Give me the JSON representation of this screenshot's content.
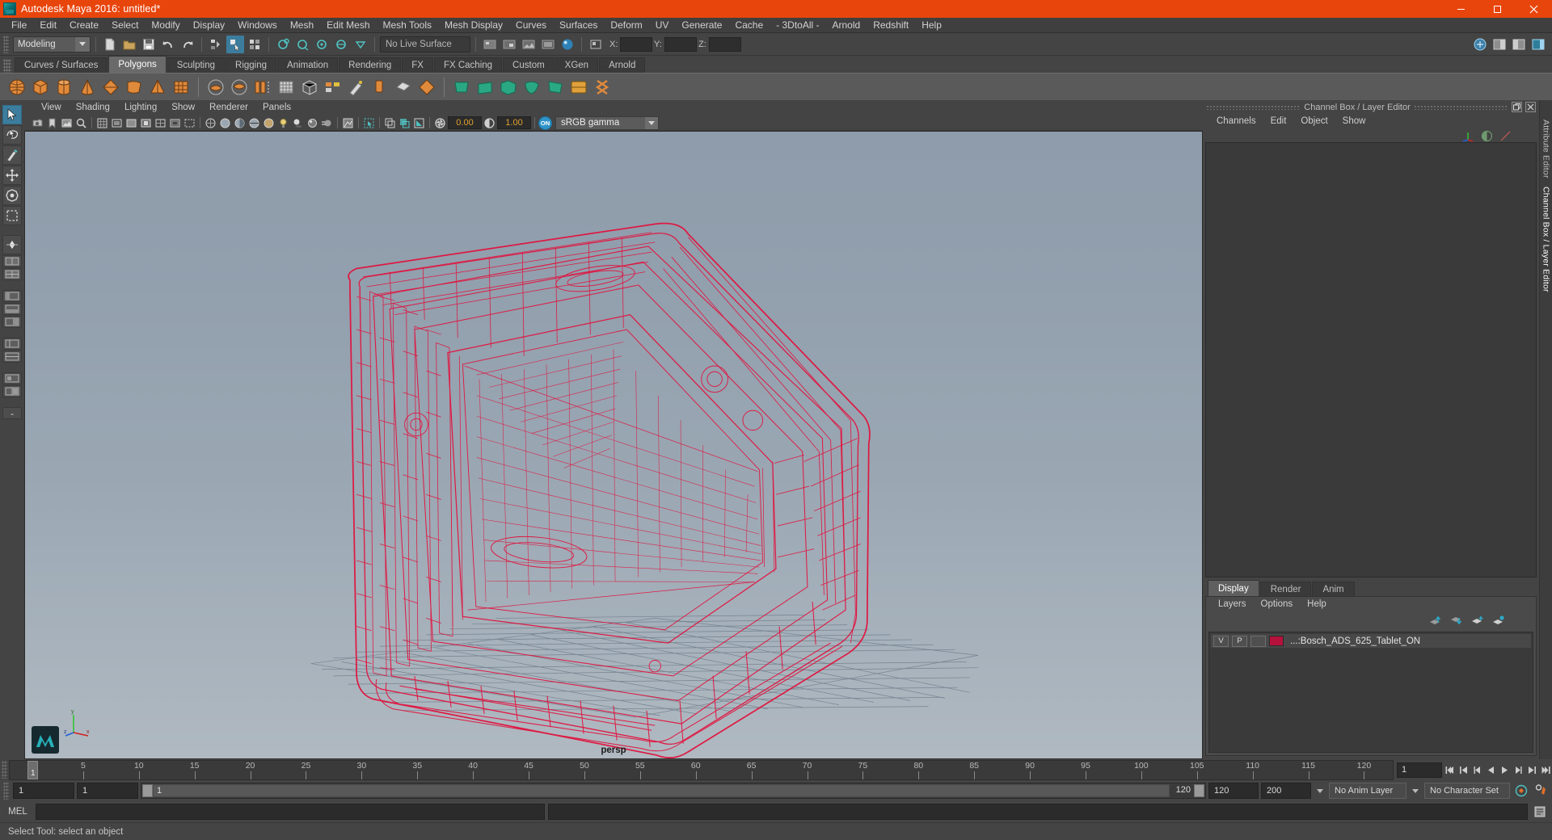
{
  "window": {
    "title": "Autodesk Maya 2016: untitled*",
    "app_icon": "maya-logo-icon",
    "buttons": {
      "minimize": "minimize-icon",
      "maximize": "maximize-icon",
      "close": "close-icon"
    },
    "accent_color": "#e8450c"
  },
  "menubar": {
    "items": [
      "File",
      "Edit",
      "Create",
      "Select",
      "Modify",
      "Display",
      "Windows",
      "Mesh",
      "Edit Mesh",
      "Mesh Tools",
      "Mesh Display",
      "Curves",
      "Surfaces",
      "Deform",
      "UV",
      "Generate",
      "Cache",
      "- 3DtoAll -",
      "Arnold",
      "Redshift",
      "Help"
    ]
  },
  "statusbar": {
    "menu_set": "Modeling",
    "live_surface": "No Live Surface",
    "coords": [
      {
        "label": "X:",
        "value": ""
      },
      {
        "label": "Y:",
        "value": ""
      },
      {
        "label": "Z:",
        "value": ""
      }
    ]
  },
  "shelf": {
    "tabs": [
      "Curves / Surfaces",
      "Polygons",
      "Sculpting",
      "Rigging",
      "Animation",
      "Rendering",
      "FX",
      "FX Caching",
      "Custom",
      "XGen",
      "Arnold"
    ],
    "selected_tab": "Polygons"
  },
  "viewport_panel": {
    "menus": [
      "View",
      "Shading",
      "Lighting",
      "Show",
      "Renderer",
      "Panels"
    ],
    "exposure_value": "0.00",
    "gamma_value": "1.00",
    "color_management": "sRGB gamma",
    "color_management_toggle": "ON",
    "camera_label": "persp",
    "axis_labels": {
      "x": "x",
      "y": "y",
      "z": "z"
    },
    "object_wireframe_color": "#e01540"
  },
  "right_dock": {
    "title": "Channel Box / Layer Editor",
    "channel_menus": [
      "Channels",
      "Edit",
      "Object",
      "Show"
    ],
    "vertical_tabs": [
      "Attribute Editor",
      "Channel Box / Layer Editor"
    ],
    "vertical_tab_selected": "Channel Box / Layer Editor",
    "layer_editor": {
      "tabs": [
        "Display",
        "Render",
        "Anim"
      ],
      "selected_tab": "Display",
      "menus": [
        "Layers",
        "Options",
        "Help"
      ],
      "layers": [
        {
          "visibility": "V",
          "playback": "P",
          "shading": "",
          "color": "#b4123c",
          "name": "...:Bosch_ADS_625_Tablet_ON"
        }
      ]
    }
  },
  "timeline": {
    "current_frame_marker": "1",
    "ticks": [
      5,
      10,
      15,
      20,
      25,
      30,
      35,
      40,
      45,
      50,
      55,
      60,
      65,
      70,
      75,
      80,
      85,
      90,
      95,
      100,
      105,
      110,
      115,
      120
    ],
    "current_frame_field": "1",
    "playback_buttons": [
      "go-to-start-icon",
      "step-back-key-icon",
      "step-back-frame-icon",
      "play-backwards-icon",
      "play-forwards-icon",
      "step-forward-frame-icon",
      "step-forward-key-icon",
      "go-to-end-icon"
    ]
  },
  "range_slider": {
    "anim_start": "1",
    "range_start": "1",
    "range_bar_start": "1",
    "range_bar_end": "120",
    "range_end": "120",
    "anim_end": "200",
    "anim_layer": "No Anim Layer",
    "character_set": "No Character Set"
  },
  "command_line": {
    "label": "MEL",
    "input_value": "",
    "result_value": ""
  },
  "status_line": {
    "message": "Select Tool: select an object"
  }
}
